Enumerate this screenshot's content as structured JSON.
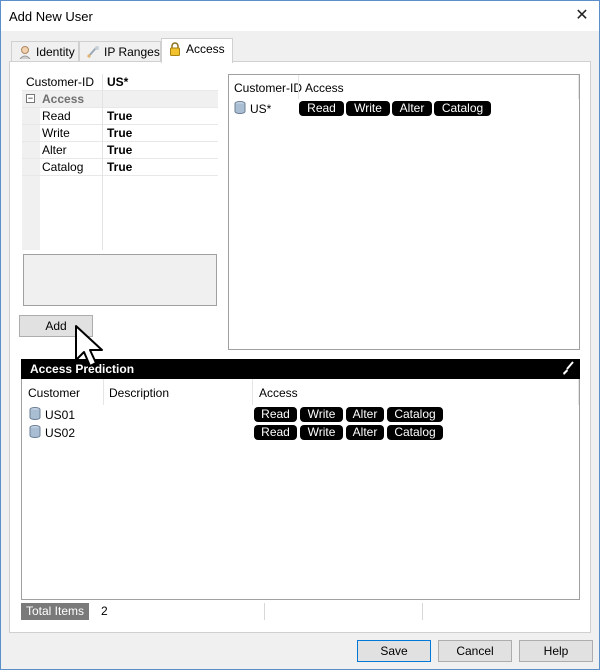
{
  "window": {
    "title": "Add New User",
    "close_glyph": "✕"
  },
  "tabs": [
    {
      "label": "Identity",
      "icon": "person-icon"
    },
    {
      "label": "IP Ranges",
      "icon": "ip-icon"
    },
    {
      "label": "Access",
      "icon": "lock-icon"
    }
  ],
  "property_grid": {
    "id_name": "Customer-ID",
    "id_value": "US*",
    "category": "Access",
    "expander": "⊟",
    "items": [
      {
        "name": "Read",
        "value": "True"
      },
      {
        "name": "Write",
        "value": "True"
      },
      {
        "name": "Alter",
        "value": "True"
      },
      {
        "name": "Catalog",
        "value": "True"
      }
    ]
  },
  "add_button": "Add",
  "rules_list": {
    "headers": [
      "Customer-ID",
      "Access"
    ],
    "rows": [
      {
        "id": "US*",
        "access": [
          "Read",
          "Write",
          "Alter",
          "Catalog"
        ]
      }
    ]
  },
  "prediction": {
    "title": "Access Prediction",
    "headers": [
      "Customer",
      "Description",
      "Access"
    ],
    "rows": [
      {
        "customer": "US01",
        "description": "",
        "access": [
          "Read",
          "Write",
          "Alter",
          "Catalog"
        ]
      },
      {
        "customer": "US02",
        "description": "",
        "access": [
          "Read",
          "Write",
          "Alter",
          "Catalog"
        ]
      }
    ]
  },
  "status": {
    "label": "Total Items",
    "value": "2"
  },
  "footer": {
    "save": "Save",
    "cancel": "Cancel",
    "help": "Help"
  },
  "colors": {
    "pill_bg": "#000000",
    "header_bg": "#000000",
    "focus_border": "#0078d7"
  }
}
